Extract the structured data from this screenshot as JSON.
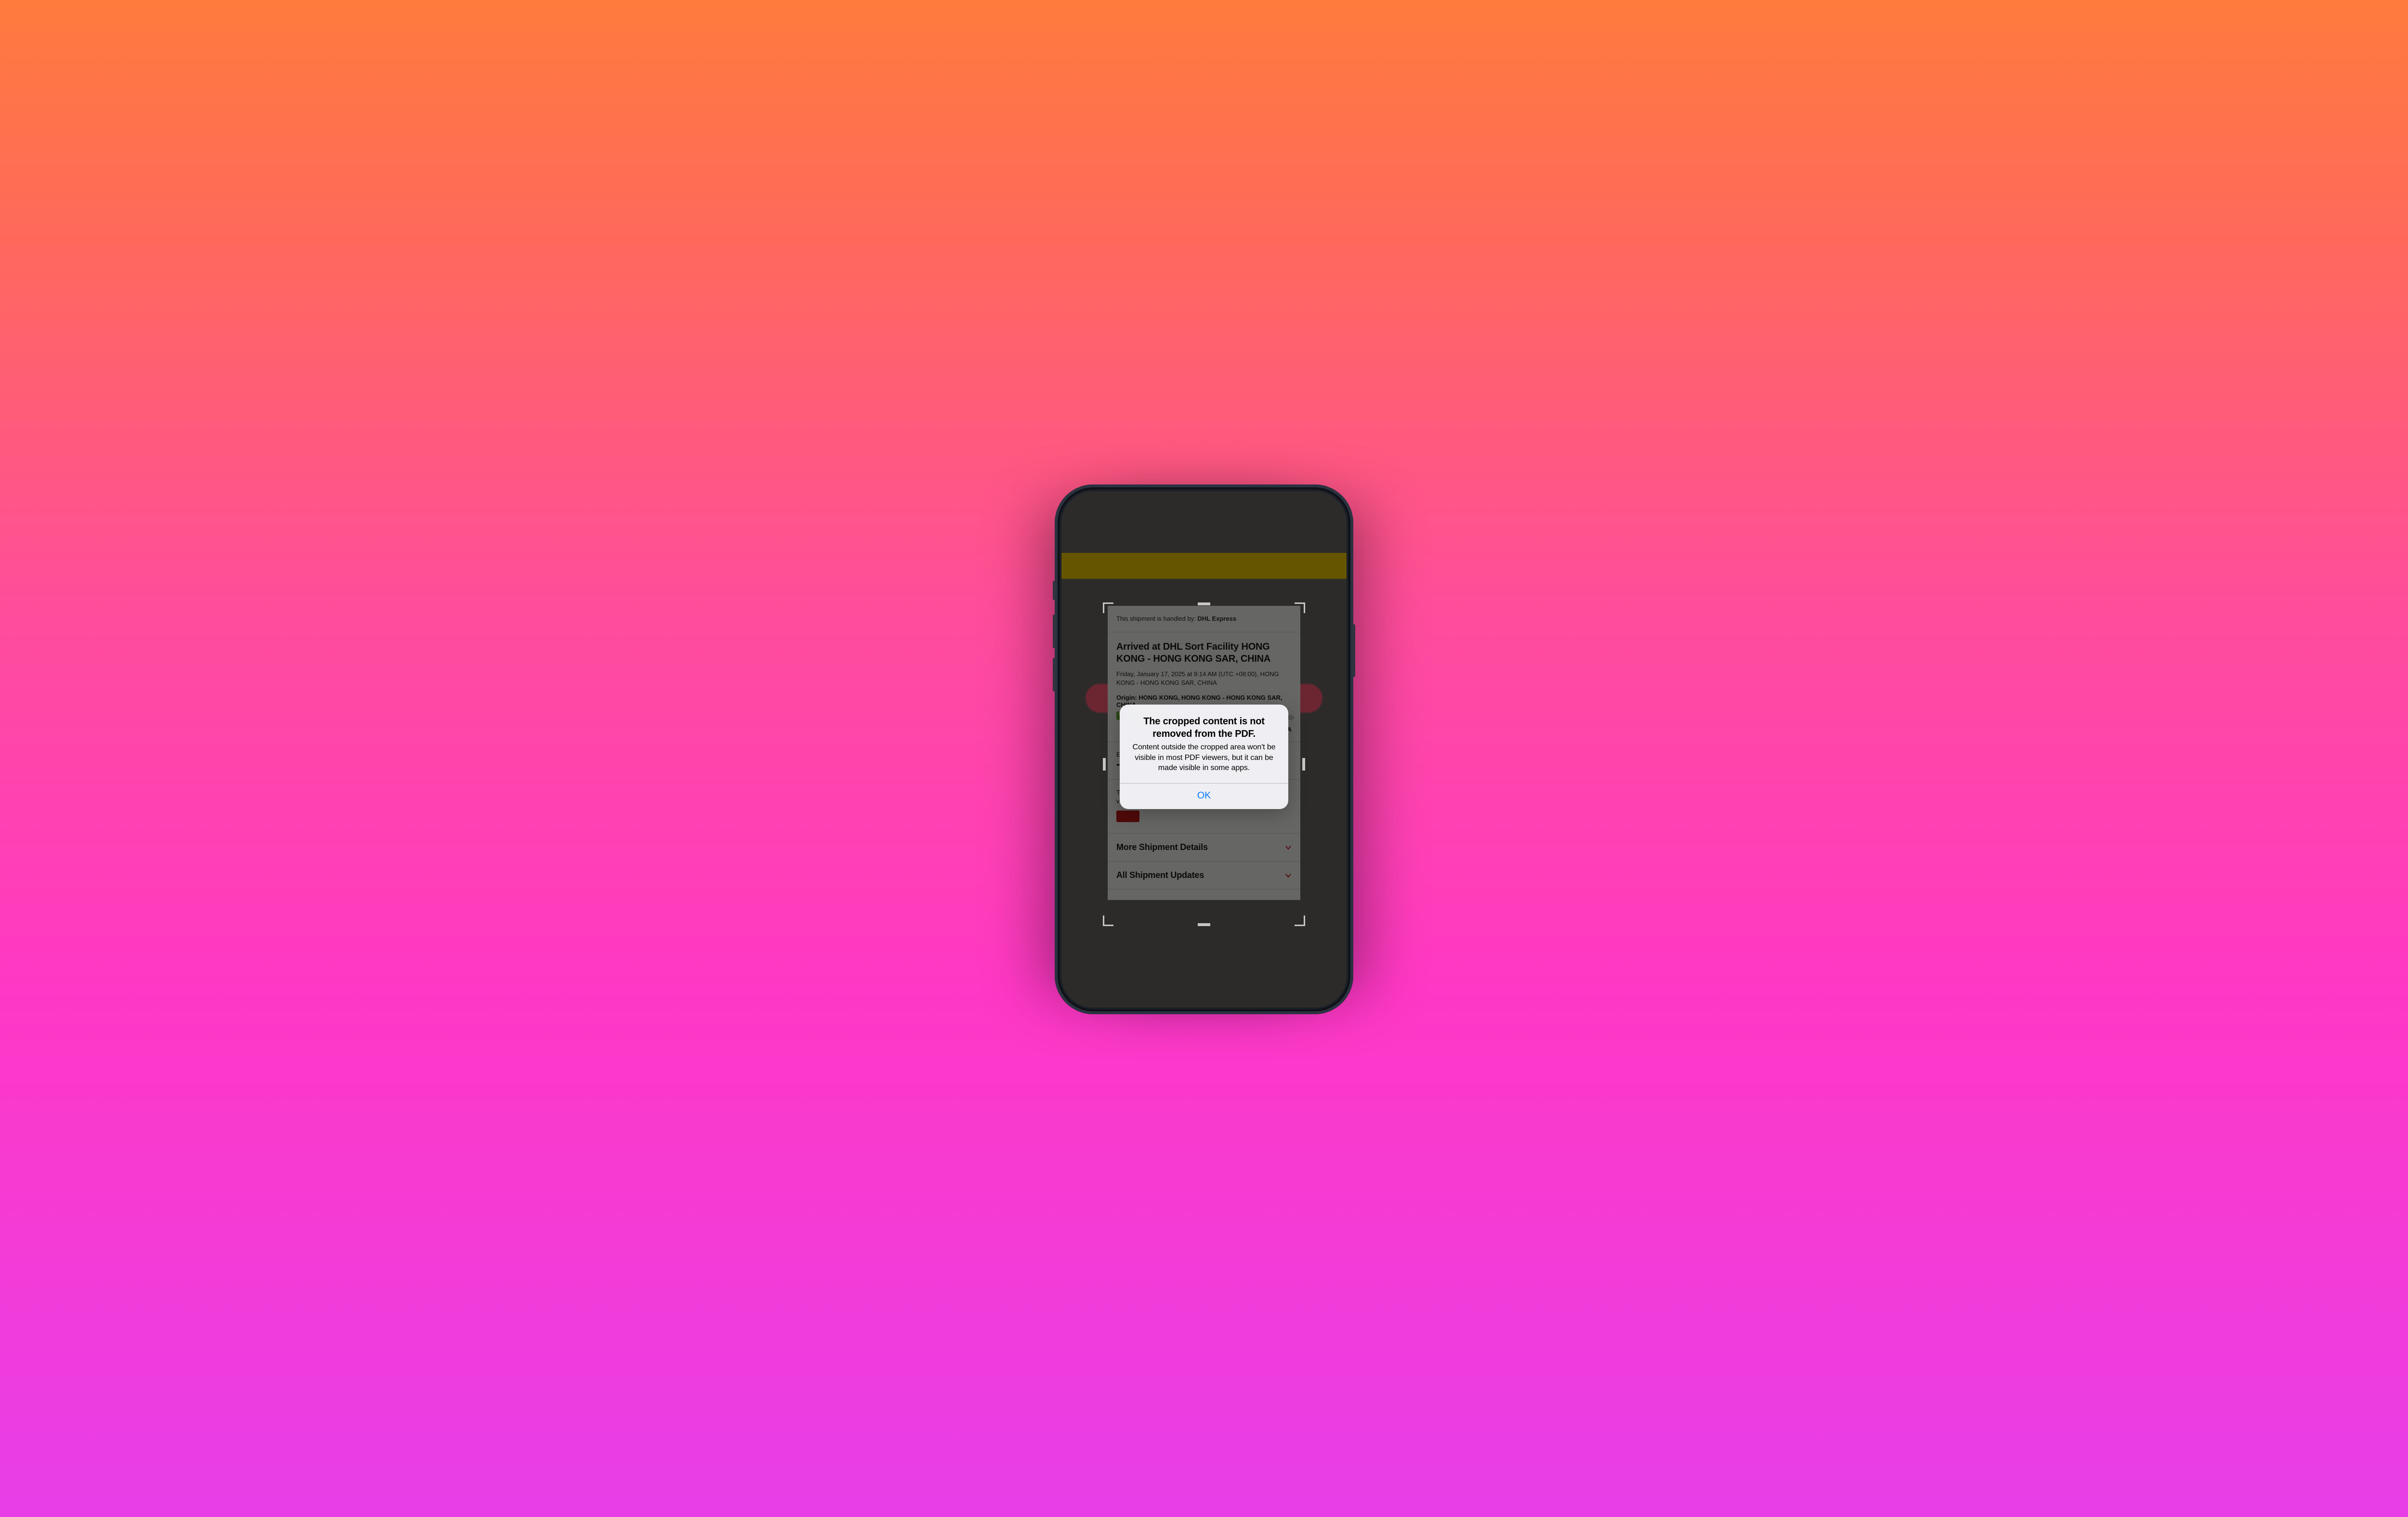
{
  "shipment": {
    "handled_by_prefix": "This shipment is handled by: ",
    "handled_by_carrier": "DHL Express",
    "status_title": "Arrived at DHL Sort Facility HONG KONG - HONG KONG SAR, CHINA",
    "status_time_location": "Friday, January 17, 2025 at 9:14 AM (UTC +08:00), HONG KONG - HONG KONG SAR, CHINA",
    "origin_label": "Origin: ",
    "origin_value": "HONG KONG, HONG KONG - HONG KONG SAR, CHINA",
    "destination_label": "",
    "destination_value_fragment": "IA",
    "eta_label": "E",
    "eta_value": "-",
    "action_note_fragment_top": "T",
    "action_note_fragment_bot": "v",
    "red_button_label": " ",
    "accordion_more": "More Shipment Details",
    "accordion_all": "All Shipment Updates"
  },
  "alert": {
    "title": "The cropped content is not removed from the PDF.",
    "message": "Content outside the cropped area won't be visible in most PDF viewers, but it can be made visible in some apps.",
    "ok": "OK"
  }
}
